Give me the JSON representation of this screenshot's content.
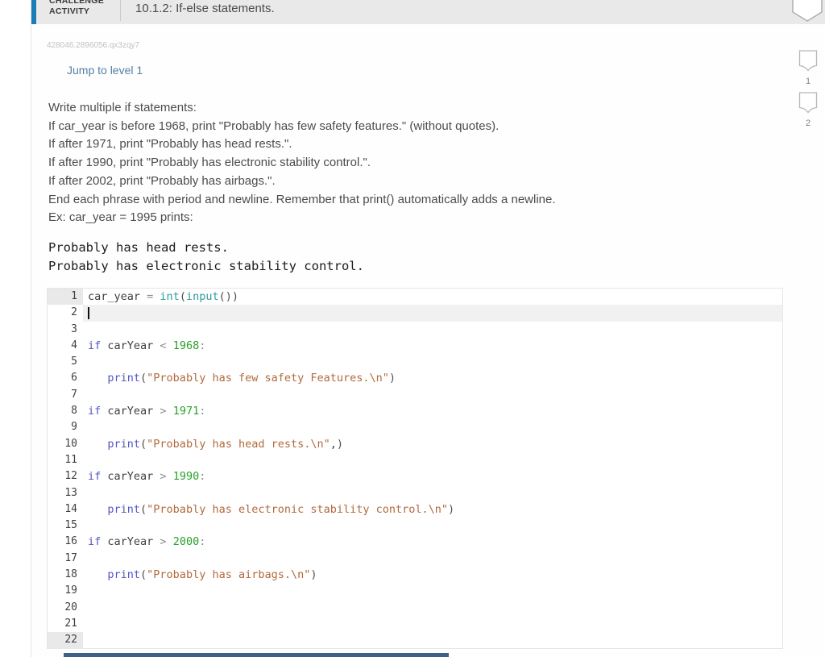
{
  "header": {
    "kicker_line1": "CHALLENGE",
    "kicker_line2": "ACTIVITY",
    "title": "10.1.2: If-else statements.",
    "accent_color": "#1b7db6"
  },
  "activity": {
    "id_code": "428046.2896056.qx3zqy7",
    "jump_link_label": "Jump to level 1",
    "levels": [
      {
        "label": "1"
      },
      {
        "label": "2"
      }
    ]
  },
  "problem": {
    "lines": [
      "Write multiple if statements:",
      "If car_year is before 1968, print \"Probably has few safety features.\" (without quotes).",
      "If after 1971, print \"Probably has head rests.\".",
      "If after 1990, print \"Probably has electronic stability control.\".",
      "If after 2002, print \"Probably has airbags.\".",
      "End each phrase with period and newline. Remember that print() automatically adds a newline.",
      "Ex: car_year = 1995 prints:"
    ],
    "example_output": [
      "Probably has head rests.",
      "Probably has electronic stability control."
    ]
  },
  "editor": {
    "active_line": 2,
    "gutter_highlight": [
      1,
      22
    ],
    "lines": [
      {
        "n": 1,
        "tokens": [
          [
            "car_year ",
            "pln"
          ],
          [
            "= ",
            "opr"
          ],
          [
            "int",
            "fn"
          ],
          [
            "(",
            "par"
          ],
          [
            "input",
            "fn"
          ],
          [
            "())",
            "par"
          ]
        ]
      },
      {
        "n": 2,
        "tokens": []
      },
      {
        "n": 3,
        "tokens": []
      },
      {
        "n": 4,
        "tokens": [
          [
            "if",
            "kw"
          ],
          [
            " carYear ",
            "pln"
          ],
          [
            "<",
            "opr"
          ],
          [
            " ",
            "pln"
          ],
          [
            "1968",
            "num"
          ],
          [
            ":",
            "opr"
          ]
        ]
      },
      {
        "n": 5,
        "tokens": []
      },
      {
        "n": 6,
        "tokens": [
          [
            "   ",
            "pln"
          ],
          [
            "print",
            "kw"
          ],
          [
            "(",
            "par"
          ],
          [
            "\"Probably has few safety Features.\\n\"",
            "str"
          ],
          [
            ")",
            "par"
          ]
        ]
      },
      {
        "n": 7,
        "tokens": []
      },
      {
        "n": 8,
        "tokens": [
          [
            "if",
            "kw"
          ],
          [
            " carYear ",
            "pln"
          ],
          [
            ">",
            "opr"
          ],
          [
            " ",
            "pln"
          ],
          [
            "1971",
            "num"
          ],
          [
            ":",
            "opr"
          ]
        ]
      },
      {
        "n": 9,
        "tokens": []
      },
      {
        "n": 10,
        "tokens": [
          [
            "   ",
            "pln"
          ],
          [
            "print",
            "kw"
          ],
          [
            "(",
            "par"
          ],
          [
            "\"Probably has head rests.\\n\"",
            "str"
          ],
          [
            ",",
            "pln"
          ],
          [
            ")",
            "par"
          ]
        ]
      },
      {
        "n": 11,
        "tokens": []
      },
      {
        "n": 12,
        "tokens": [
          [
            "if",
            "kw"
          ],
          [
            " carYear ",
            "pln"
          ],
          [
            ">",
            "opr"
          ],
          [
            " ",
            "pln"
          ],
          [
            "1990",
            "num"
          ],
          [
            ":",
            "opr"
          ]
        ]
      },
      {
        "n": 13,
        "tokens": []
      },
      {
        "n": 14,
        "tokens": [
          [
            "   ",
            "pln"
          ],
          [
            "print",
            "kw"
          ],
          [
            "(",
            "par"
          ],
          [
            "\"Probably has electronic stability control.\\n\"",
            "str"
          ],
          [
            ")",
            "par"
          ]
        ]
      },
      {
        "n": 15,
        "tokens": []
      },
      {
        "n": 16,
        "tokens": [
          [
            "if",
            "kw"
          ],
          [
            " carYear ",
            "pln"
          ],
          [
            ">",
            "opr"
          ],
          [
            " ",
            "pln"
          ],
          [
            "2000",
            "num"
          ],
          [
            ":",
            "opr"
          ]
        ]
      },
      {
        "n": 17,
        "tokens": []
      },
      {
        "n": 18,
        "tokens": [
          [
            "   ",
            "pln"
          ],
          [
            "print",
            "kw"
          ],
          [
            "(",
            "par"
          ],
          [
            "\"Probably has airbags.\\n\"",
            "str"
          ],
          [
            ")",
            "par"
          ]
        ]
      },
      {
        "n": 19,
        "tokens": []
      },
      {
        "n": 20,
        "tokens": []
      },
      {
        "n": 21,
        "tokens": []
      },
      {
        "n": 22,
        "tokens": []
      }
    ]
  },
  "colors": {
    "header_accent": "#1b7db6",
    "header_bg": "#e9e9e9",
    "link": "#527ea6",
    "bottom_bar": "#3e6189",
    "syntax_keyword": "#5356c6",
    "syntax_builtin": "#2f9c9c",
    "syntax_number": "#28a228",
    "syntax_string": "#b2693c",
    "syntax_operator": "#8d8d8d",
    "active_line_bg": "#f1f1f1"
  }
}
